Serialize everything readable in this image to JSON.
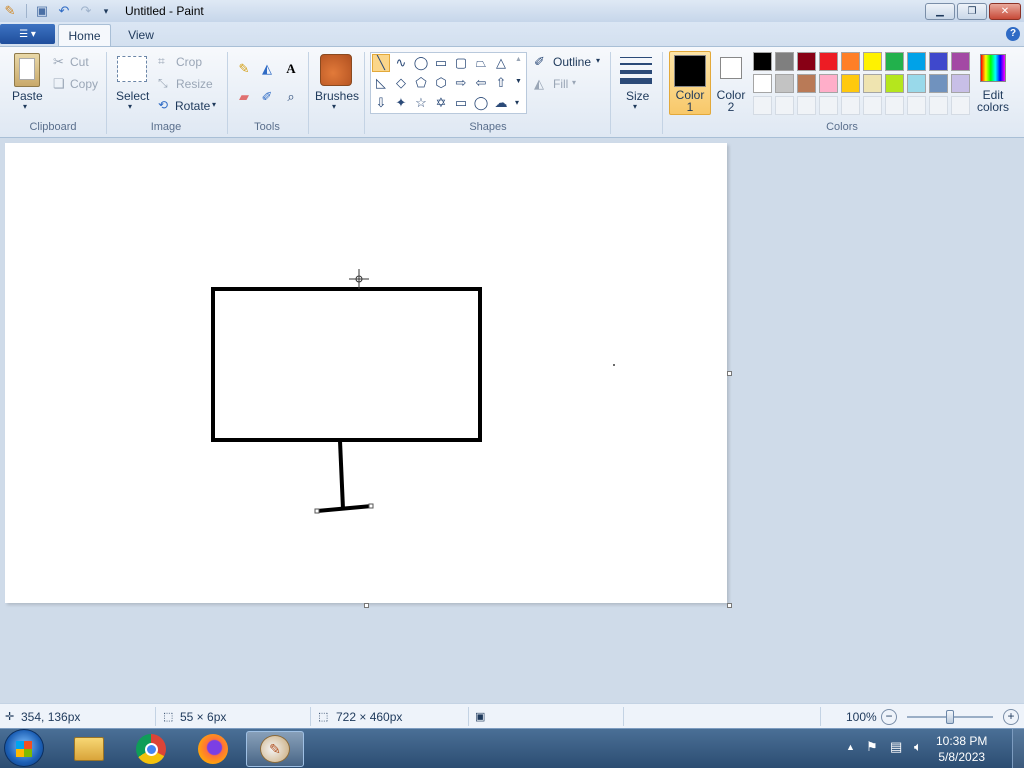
{
  "window": {
    "title": "Untitled - Paint"
  },
  "tabs": {
    "home": "Home",
    "view": "View"
  },
  "clipboard": {
    "paste": "Paste",
    "cut": "Cut",
    "copy": "Copy",
    "group": "Clipboard"
  },
  "image": {
    "select": "Select",
    "crop": "Crop",
    "resize": "Resize",
    "rotate": "Rotate",
    "group": "Image"
  },
  "tools": {
    "group": "Tools"
  },
  "brushes": {
    "label": "Brushes"
  },
  "shapes": {
    "outline": "Outline",
    "fill": "Fill",
    "group": "Shapes"
  },
  "size": {
    "label": "Size"
  },
  "colors": {
    "color1_line1": "Color",
    "color1_line2": "1",
    "color2_line1": "Color",
    "color2_line2": "2",
    "edit_line1": "Edit",
    "edit_line2": "colors",
    "group": "Colors",
    "color1_value": "#000000",
    "color2_value": "#ffffff",
    "palette_row1": [
      "#000000",
      "#7f7f7f",
      "#880015",
      "#ed1c24",
      "#ff7f27",
      "#fff200",
      "#22b14c",
      "#00a2e8",
      "#3f48cc",
      "#a349a4"
    ],
    "palette_row2": [
      "#ffffff",
      "#c3c3c3",
      "#b97a57",
      "#ffaec9",
      "#ffc90e",
      "#efe4b0",
      "#b5e61d",
      "#99d9ea",
      "#7092be",
      "#c8bfe7"
    ]
  },
  "status": {
    "cursor_pos": "354, 136px",
    "selection_size": "55 × 6px",
    "canvas_size": "722 × 460px",
    "zoom": "100%",
    "zoom_level": 0.5
  },
  "taskbar": {
    "time": "10:38 PM",
    "date": "5/8/2023"
  }
}
